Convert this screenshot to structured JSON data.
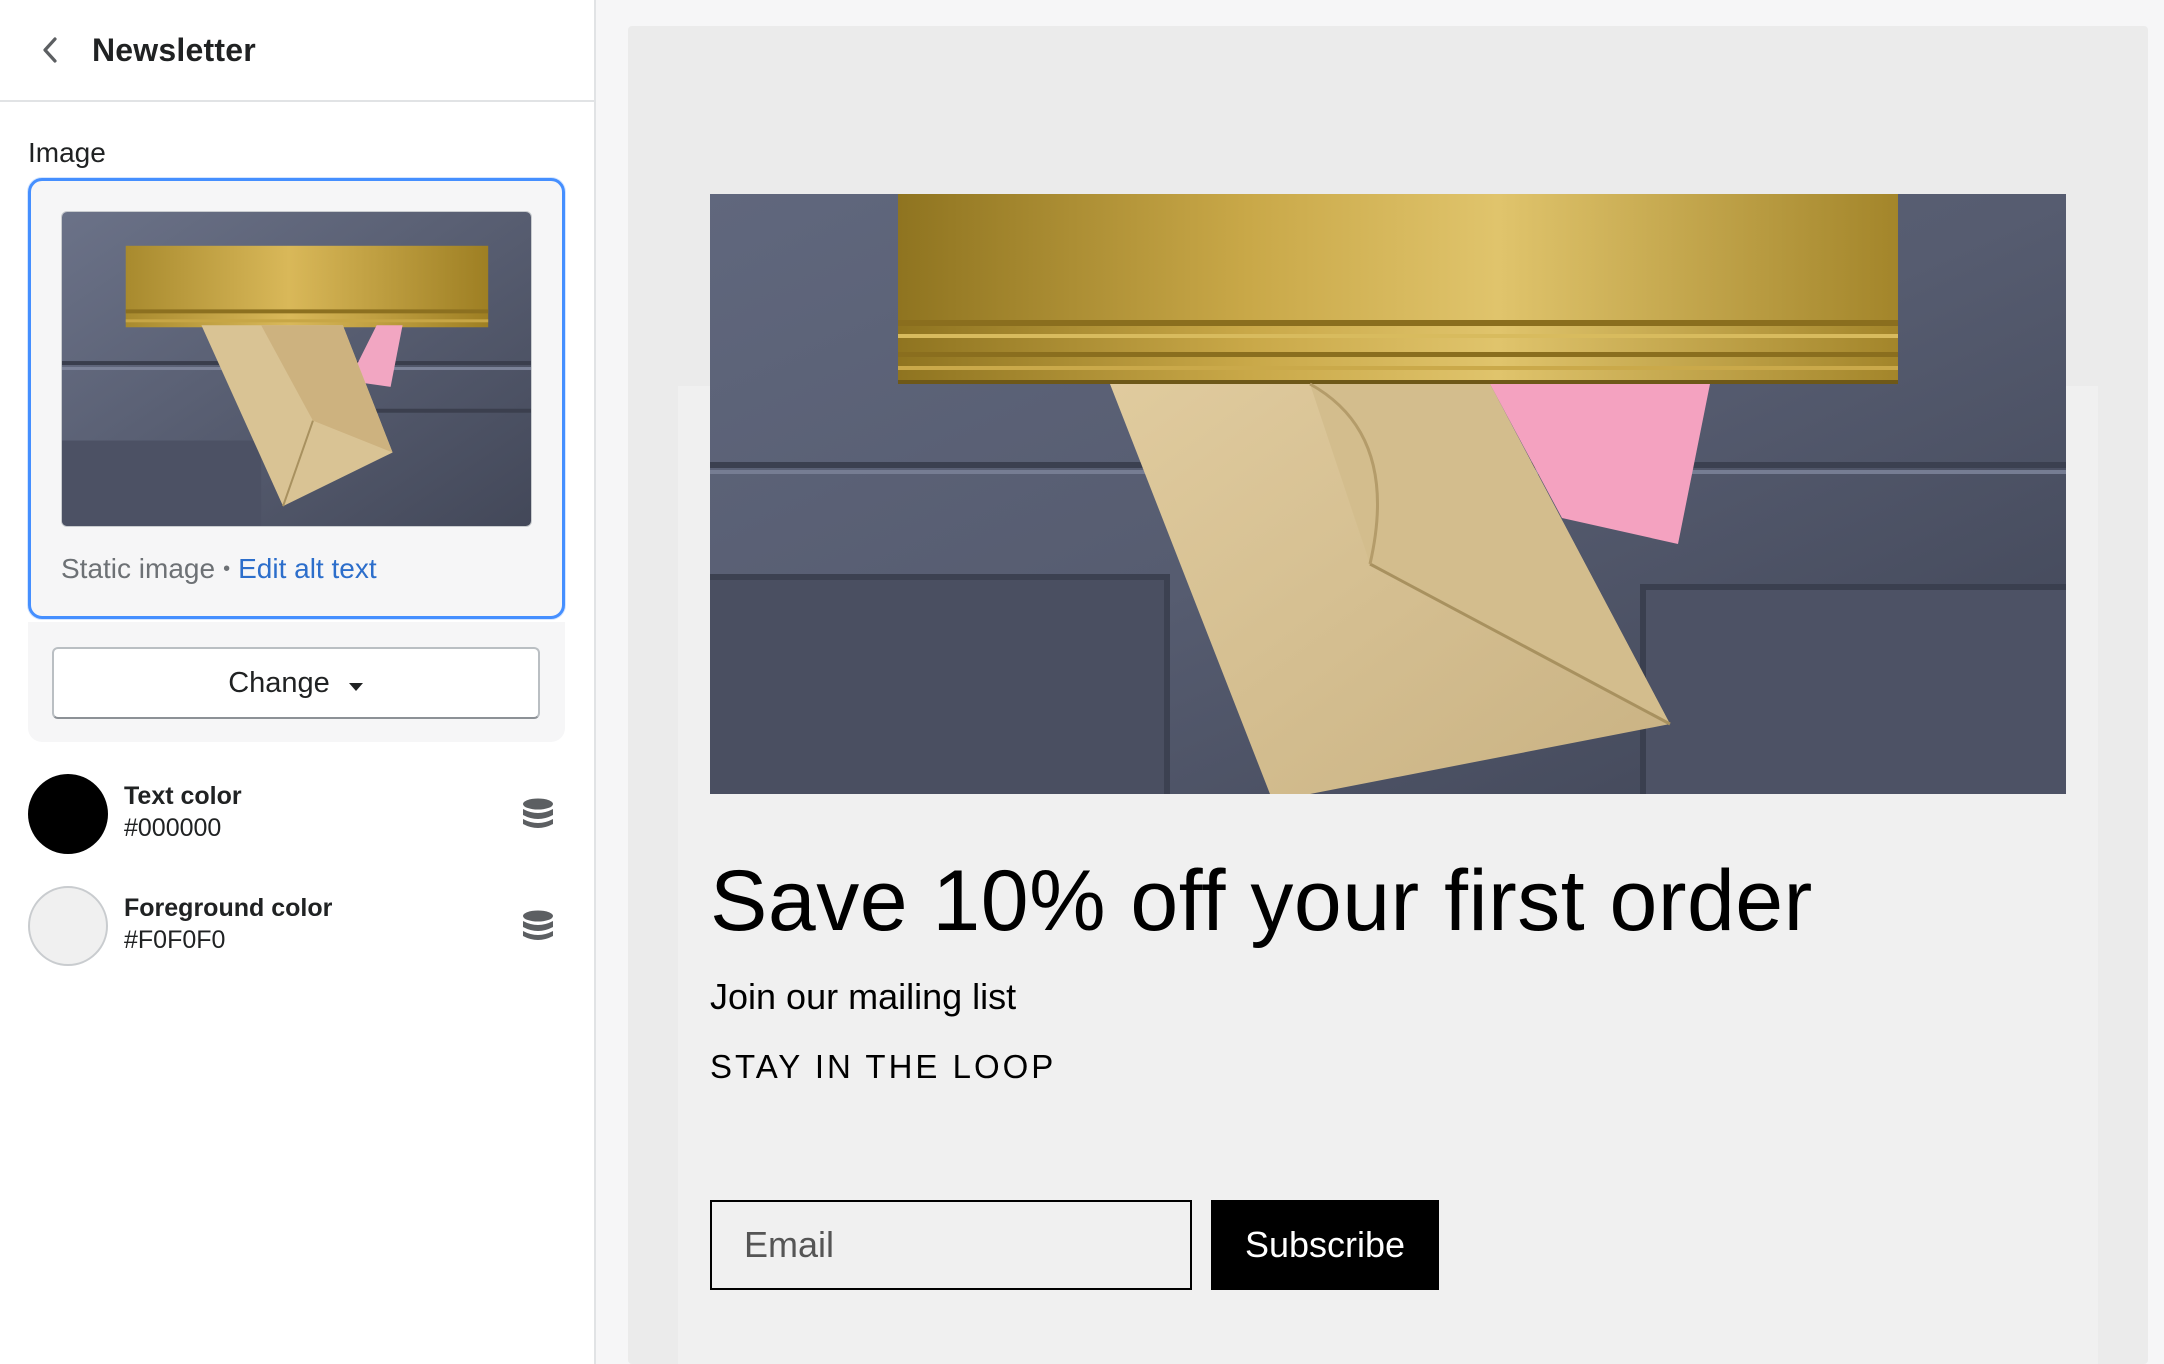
{
  "sidebar": {
    "title": "Newsletter",
    "image_field": {
      "label": "Image",
      "type_text": "Static image",
      "separator": "•",
      "edit_alt_link": "Edit alt text",
      "change_button_label": "Change"
    },
    "colors": [
      {
        "name": "Text color",
        "value": "#000000",
        "swatch": "#000000",
        "icon": "database-icon"
      },
      {
        "name": "Foreground color",
        "value": "#F0F0F0",
        "swatch": "#F0F0F0",
        "icon": "database-icon"
      }
    ]
  },
  "preview": {
    "heading": "Save 10% off your first order",
    "subheading": "Join our mailing list",
    "tagline": "STAY IN THE LOOP",
    "email_placeholder": "Email",
    "subscribe_label": "Subscribe",
    "image_subject": "mail-slot-envelope-photo"
  },
  "theme": {
    "accent": "#458FFF",
    "link": "#2C6ECB",
    "button_bg": "#000000",
    "button_fg": "#FFFFFF"
  }
}
